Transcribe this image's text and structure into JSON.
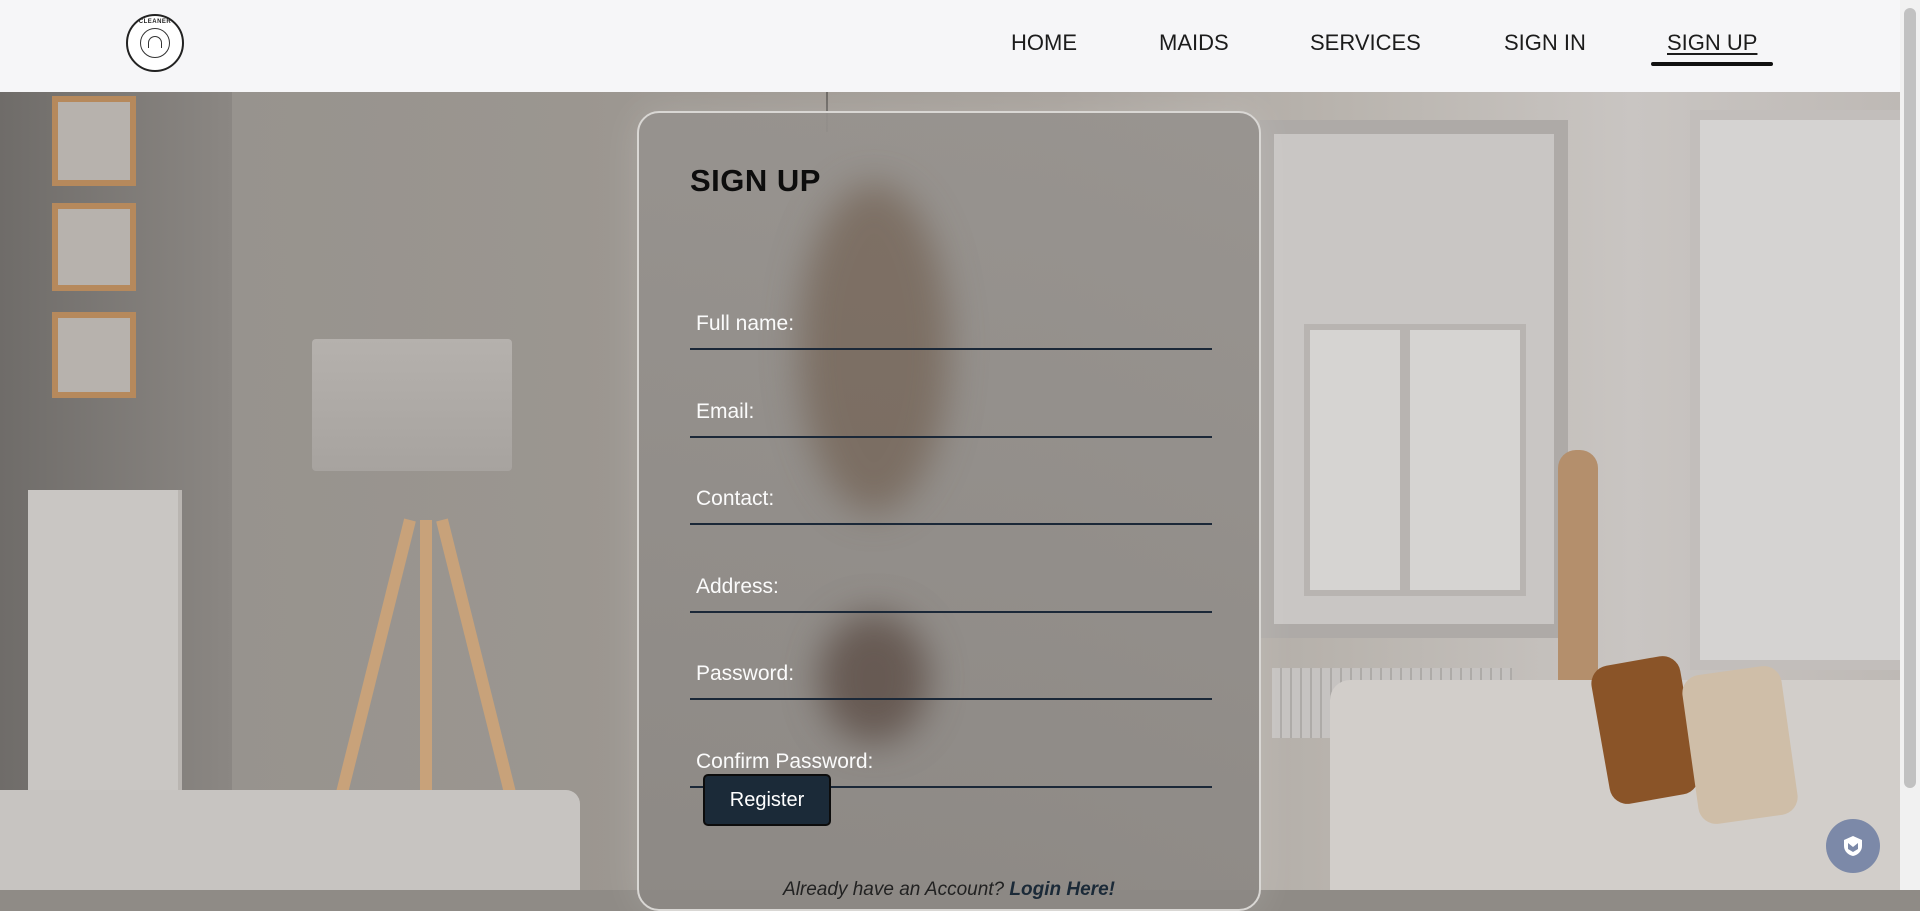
{
  "logo": {
    "brand_text": "CLEANER",
    "icon": "bell-logo-icon"
  },
  "nav": {
    "items": [
      {
        "label": "HOME",
        "active": false
      },
      {
        "label": "MAIDS",
        "active": false
      },
      {
        "label": "SERVICES",
        "active": false
      },
      {
        "label": "SIGN IN",
        "active": false
      },
      {
        "label": "SIGN UP",
        "active": true
      }
    ]
  },
  "form": {
    "title": "SIGN UP",
    "fields": [
      {
        "placeholder": "Full name:",
        "value": ""
      },
      {
        "placeholder": "Email:",
        "value": ""
      },
      {
        "placeholder": "Contact:",
        "value": ""
      },
      {
        "placeholder": "Address:",
        "value": ""
      },
      {
        "placeholder": "Password:",
        "value": ""
      },
      {
        "placeholder": "Confirm Password:",
        "value": ""
      }
    ],
    "register_label": "Register",
    "already_text": "Already have an Account?",
    "login_link": "Login Here!"
  },
  "badge": {
    "icon": "shield-icon"
  },
  "colors": {
    "button_bg": "#1b2a38",
    "header_bg": "#f6f6f8",
    "badge_bg": "#7c89a8"
  }
}
